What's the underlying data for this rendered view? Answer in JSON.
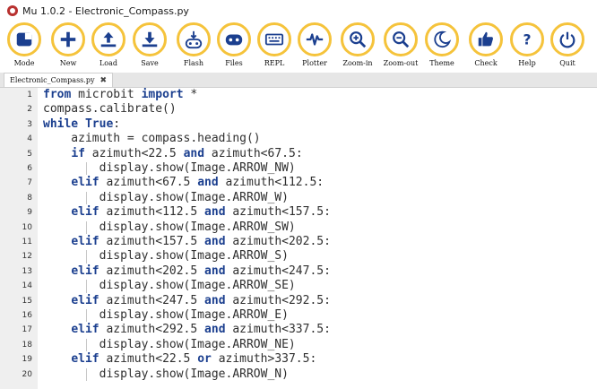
{
  "window": {
    "title": "Mu 1.0.2 - Electronic_Compass.py"
  },
  "toolbar": [
    {
      "id": "mode",
      "label": "Mode",
      "icon": "mode-icon"
    },
    {
      "id": "new",
      "label": "New",
      "icon": "plus-icon"
    },
    {
      "id": "load",
      "label": "Load",
      "icon": "upload-icon"
    },
    {
      "id": "save",
      "label": "Save",
      "icon": "download-icon"
    },
    {
      "id": "flash",
      "label": "Flash",
      "icon": "flash-icon"
    },
    {
      "id": "files",
      "label": "Files",
      "icon": "files-icon"
    },
    {
      "id": "repl",
      "label": "REPL",
      "icon": "keyboard-icon"
    },
    {
      "id": "plotter",
      "label": "Plotter",
      "icon": "pulse-icon"
    },
    {
      "id": "zoom-in",
      "label": "Zoom-in",
      "icon": "zoom-in-icon"
    },
    {
      "id": "zoom-out",
      "label": "Zoom-out",
      "icon": "zoom-out-icon"
    },
    {
      "id": "theme",
      "label": "Theme",
      "icon": "moon-icon"
    },
    {
      "id": "check",
      "label": "Check",
      "icon": "thumbs-up-icon"
    },
    {
      "id": "help",
      "label": "Help",
      "icon": "question-icon"
    },
    {
      "id": "quit",
      "label": "Quit",
      "icon": "power-icon"
    }
  ],
  "tabs": [
    {
      "label": "Electronic_Compass.py",
      "close": "✖"
    }
  ],
  "code_lines": [
    "from microbit import *",
    "compass.calibrate()",
    "while True:",
    "    azimuth = compass.heading()",
    "    if azimuth<22.5 and azimuth<67.5:",
    "        display.show(Image.ARROW_NW)",
    "    elif azimuth<67.5 and azimuth<112.5:",
    "        display.show(Image.ARROW_W)",
    "    elif azimuth<112.5 and azimuth<157.5:",
    "        display.show(Image.ARROW_SW)",
    "    elif azimuth<157.5 and azimuth<202.5:",
    "        display.show(Image.ARROW_S)",
    "    elif azimuth<202.5 and azimuth<247.5:",
    "        display.show(Image.ARROW_SE)",
    "    elif azimuth<247.5 and azimuth<292.5:",
    "        display.show(Image.ARROW_E)",
    "    elif azimuth<292.5 and azimuth<337.5:",
    "        display.show(Image.ARROW_NE)",
    "    elif azimuth<22.5 or azimuth>337.5:",
    "        display.show(Image.ARROW_N)"
  ],
  "colors": {
    "accent": "#f5c33b",
    "icon": "#1b3f8f",
    "keyword": "#1b3f8f"
  }
}
